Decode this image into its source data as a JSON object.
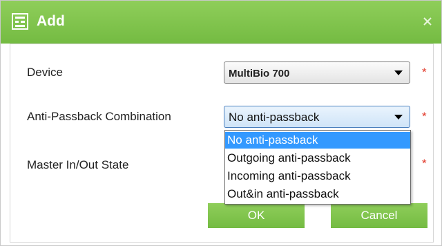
{
  "dialog": {
    "title": "Add",
    "title_icon": "add-form-icon",
    "close_icon": "close-icon"
  },
  "form": {
    "device": {
      "label": "Device",
      "value": "MultiBio 700",
      "required_mark": "*"
    },
    "anti_passback": {
      "label": "Anti-Passback Combination",
      "value": "No anti-passback",
      "required_mark": "*",
      "options": [
        "No anti-passback",
        "Outgoing anti-passback",
        "Incoming anti-passback",
        "Out&in anti-passback"
      ],
      "selected_index": 0
    },
    "master_state": {
      "label": "Master In/Out State",
      "required_mark": "*"
    }
  },
  "buttons": {
    "ok": "OK",
    "cancel": "Cancel"
  },
  "colors": {
    "titlebar": "#7dc24b",
    "button": "#7dc24b",
    "highlight": "#3399ff",
    "required": "#e23b2c"
  }
}
